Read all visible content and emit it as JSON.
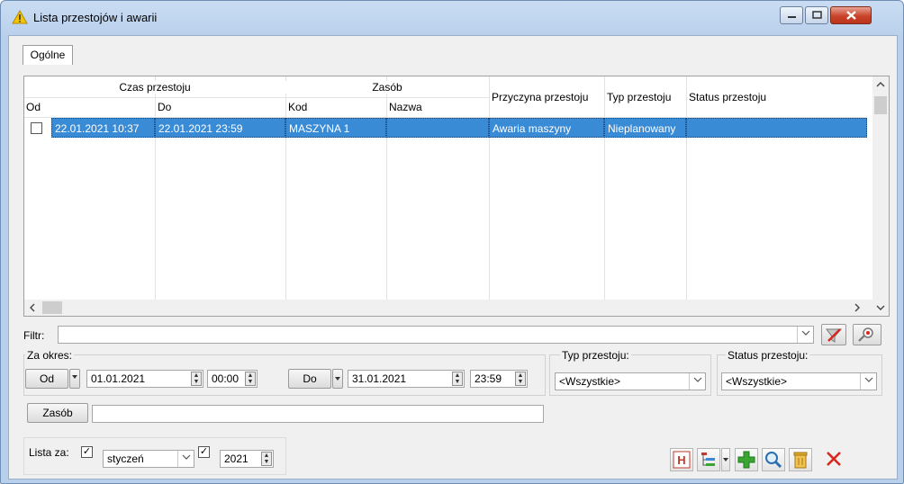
{
  "window": {
    "title": "Lista przestojów i awarii",
    "icon": "warning-icon"
  },
  "tabs": [
    {
      "label": "Ogólne",
      "active": true
    }
  ],
  "grid": {
    "group_headers": {
      "czas": "Czas przestoju",
      "zasob": "Zasób"
    },
    "columns": {
      "od": "Od",
      "do": "Do",
      "kod": "Kod",
      "nazwa": "Nazwa",
      "przyczyna": "Przyczyna przestoju",
      "typ": "Typ przestoju",
      "status": "Status przestoju"
    },
    "rows": [
      {
        "od": "22.01.2021 10:37",
        "do": "22.01.2021 23:59",
        "kod": "MASZYNA 1",
        "nazwa": "",
        "przyczyna": "Awaria maszyny",
        "typ": "Nieplanowany",
        "status": "",
        "selected": true
      }
    ]
  },
  "filter": {
    "label": "Filtr:",
    "value": ""
  },
  "period": {
    "label": "Za okres:",
    "from_button": "Od",
    "from_date": "01.01.2021",
    "from_time": "00:00",
    "to_button": "Do",
    "to_date": "31.01.2021",
    "to_time": "23:59"
  },
  "typ_przestoju": {
    "label": "Typ przestoju:",
    "value": "<Wszystkie>"
  },
  "status_przestoju": {
    "label": "Status przestoju:",
    "value": "<Wszystkie>"
  },
  "zasob": {
    "button": "Zasób",
    "value": ""
  },
  "lista_za": {
    "label": "Lista za:",
    "month": "styczeń",
    "year": "2021",
    "month_checked": true,
    "year_checked": true
  },
  "colors": {
    "selection": "#3a8bd6",
    "accent_red": "#d7281e",
    "accent_green": "#3aa632"
  }
}
